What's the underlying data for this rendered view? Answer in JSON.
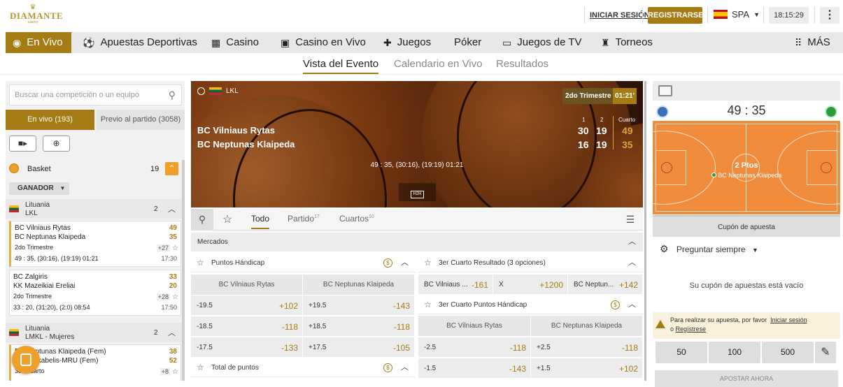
{
  "header": {
    "logo_text": "DIAMANTE",
    "logo_sub": "casino",
    "login": "INICIAR SESIÓN",
    "register": "REGISTRARSE",
    "language": "SPA",
    "time": "18:15:29"
  },
  "nav": [
    {
      "label": "En Vivo",
      "icon": "radio-icon"
    },
    {
      "label": "Apuestas Deportivas",
      "icon": "sports-icon"
    },
    {
      "label": "Casino",
      "icon": "slot-icon"
    },
    {
      "label": "Casino en Vivo",
      "icon": "live-casino-icon"
    },
    {
      "label": "Juegos",
      "icon": "gamepad-icon"
    },
    {
      "label": "Póker",
      "icon": "cards-icon"
    },
    {
      "label": "Juegos de TV",
      "icon": "tv-icon"
    },
    {
      "label": "Torneos",
      "icon": "trophy-icon"
    },
    {
      "label": "MÁS",
      "icon": "grid-icon"
    }
  ],
  "subnav": [
    "Vista del Evento",
    "Calendario en Vivo",
    "Resultados"
  ],
  "sidebar": {
    "search_placeholder": "Buscar una competición o un equipo",
    "tab_live": "En vivo (193)",
    "tab_pre": "Previo al partido (3058)",
    "sport": "Basket",
    "sport_count": "19",
    "market_filter": "GANADOR",
    "leagues": [
      {
        "country": "Lituania",
        "name": "LKL",
        "count": "2"
      },
      {
        "country": "Lituania",
        "name": "LMKL - Mujeres",
        "count": "2"
      }
    ],
    "matches": [
      {
        "home": "BC Vilniaus Rytas",
        "away": "BC Neptunas Klaipeda",
        "hs": "49",
        "as": "35",
        "period": "2do Trimestre",
        "more": "+27",
        "detail": "49 : 35, (30:16), (19:19) 01:21",
        "time": "17:30"
      },
      {
        "home": "BC Zalgiris",
        "away": "KK Mazeikiai Ereliai",
        "hs": "33",
        "as": "20",
        "period": "2do Trimestre",
        "more": "+28",
        "detail": "33 : 20, (31:20), (2:0) 08:54",
        "time": "17:50"
      },
      {
        "home": "BC Neptunas Klaipeda (Fem)",
        "away": "BC Lietkabelis-MRU (Fem)",
        "hs": "38",
        "as": "52",
        "period": "3er Cuarto",
        "more": "+8"
      }
    ]
  },
  "event": {
    "league": "LKL",
    "period": "2do Trimestre",
    "clock": "01:21'",
    "home": "BC Vilniaus Rytas",
    "away": "BC Neptunas Klaipeda",
    "col1": "1",
    "col2": "2",
    "colq": "Cuarto",
    "home_q1": "30",
    "home_q2": "19",
    "home_cur": "49",
    "away_q1": "16",
    "away_q2": "19",
    "away_cur": "35",
    "summary": "49 : 35, (30:16), (19:19) 01:21",
    "h2h": "H2H"
  },
  "market_tabs": {
    "todo": "Todo",
    "partido": "Partido",
    "partido_n": "17",
    "cuartos": "Cuartos",
    "cuartos_n": "10"
  },
  "markets": {
    "title": "Mercados",
    "handicap": {
      "title": "Puntos Hándicap",
      "home": "BC Vilniaus Rytas",
      "away": "BC Neptunas Klaipeda",
      "rows": [
        {
          "hl": "-19.5",
          "ho": "+102",
          "al": "+19.5",
          "ao": "-143"
        },
        {
          "hl": "-18.5",
          "ho": "-118",
          "al": "+18.5",
          "ao": "-118"
        },
        {
          "hl": "-17.5",
          "ho": "-133",
          "al": "+17.5",
          "ao": "-105"
        }
      ]
    },
    "total": {
      "title": "Total de puntos"
    },
    "q3_result": {
      "title": "3er Cuarto Resultado (3 opciones)",
      "home": "BC Vilniaus ...",
      "home_odd": "-161",
      "draw": "X",
      "draw_odd": "+1200",
      "away": "BC Neptun...",
      "away_odd": "+142"
    },
    "q3_handicap": {
      "title": "3er Cuarto Puntos Hándicap",
      "home": "BC Vilniaus Rytas",
      "away": "BC Neptunas Klaipeda",
      "rows": [
        {
          "hl": "-2.5",
          "ho": "-118",
          "al": "+2.5",
          "ao": "-118"
        },
        {
          "hl": "-1.5",
          "ho": "-143",
          "al": "+1.5",
          "ao": "+102"
        }
      ]
    }
  },
  "tracker": {
    "score": "49 : 35",
    "action": "2 Ptos",
    "team": "BC Neptunas Klaipeda"
  },
  "betslip": {
    "title": "Cupón de apuesta",
    "ask": "Preguntar siempre",
    "empty": "Su cupón de apuestas está vacío",
    "warn_a": "Para realizar su apuesta, por favor",
    "warn_login": "Iniciar sesión",
    "warn_or": "o",
    "warn_register": "Regístrese",
    "stakes": [
      "50",
      "100",
      "500"
    ],
    "place": "APOSTAR AHORA"
  },
  "colors": {
    "accent": "#a57c14",
    "orange": "#f0a028",
    "court": "#f08c3c"
  }
}
